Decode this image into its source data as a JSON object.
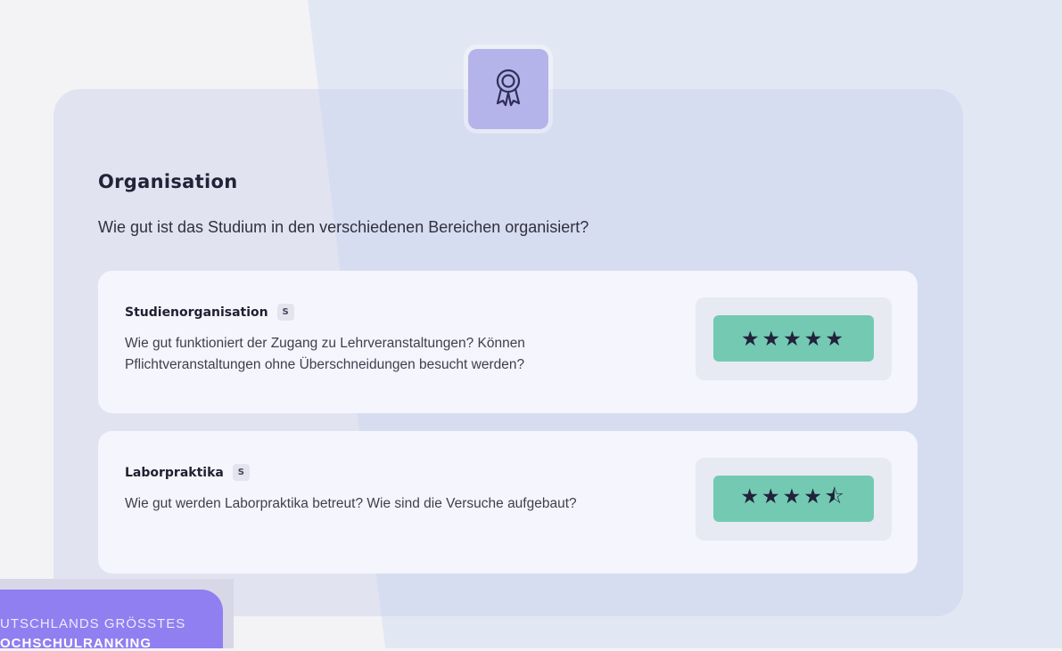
{
  "section": {
    "icon": "award-ribbon-icon",
    "title": "Organisation",
    "subtitle": "Wie gut ist das Studium in den verschiedenen Bereichen organisiert?"
  },
  "items": [
    {
      "title": "Studienorganisation",
      "badge": "S",
      "description": "Wie gut funktioniert der Zugang zu Lehrveranstaltungen? Können Pflichtveranstaltungen ohne Überschneidungen besucht werden?",
      "rating_stars": "★★★★★",
      "rating_value": 5
    },
    {
      "title": "Laborpraktika",
      "badge": "S",
      "description": "Wie gut werden Laborpraktika betreut? Wie sind die Versuche aufgebaut?",
      "rating_stars": "★★★★⯪",
      "rating_value": 4.5
    }
  ],
  "promo": {
    "line1": "UTSCHLANDS GRÖSSTES",
    "line2": "OCHSCHULRANKING"
  },
  "colors": {
    "accent_tile": "#b4b4ea",
    "rating_green": "#74c9b3",
    "promo_purple": "#8f7ff0"
  }
}
